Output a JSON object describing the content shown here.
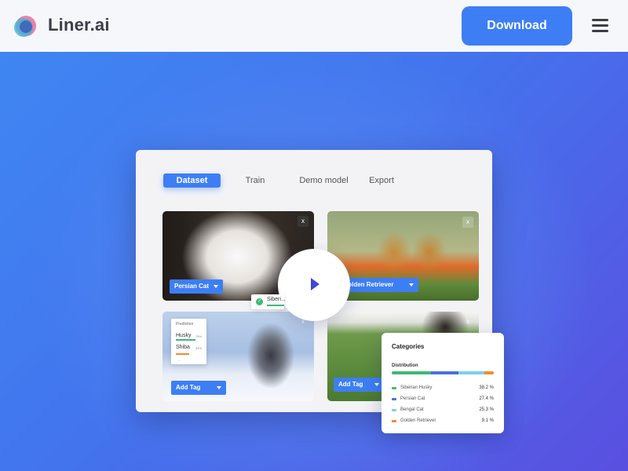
{
  "header": {
    "brand": "Liner.ai",
    "download_label": "Download"
  },
  "colors": {
    "accent": "#3d7ef5",
    "hero_start": "#3f86f2",
    "hero_end": "#5a4fe0"
  },
  "icons": {
    "logo": "liner-logo-icon",
    "menu": "hamburger-menu-icon",
    "play": "play-icon",
    "close": "close-x-icon"
  },
  "app": {
    "tabs": [
      {
        "label": "Dataset",
        "active": true
      },
      {
        "label": "Train",
        "active": false
      },
      {
        "label": "Demo model",
        "active": false
      },
      {
        "label": "Export",
        "active": false
      }
    ],
    "cards": [
      {
        "tag": "Persian Cat",
        "close": "x"
      },
      {
        "tag": "Golden Retriever",
        "close": "x"
      },
      {
        "tag": "Add Tag",
        "close": "x"
      },
      {
        "tag": "Add Tag",
        "close": "x"
      }
    ],
    "chip": {
      "label": "Siberi..."
    },
    "prediction": {
      "title": "Prediction",
      "items": [
        {
          "label": "Husky",
          "pct": "76%"
        },
        {
          "label": "Shiba",
          "pct": "34%"
        }
      ],
      "more": "—"
    },
    "categories": {
      "title": "Categories",
      "distribution_label": "Distribution",
      "items": [
        {
          "name": "Siberian Husky",
          "value": "38.2 %",
          "share": 38.2,
          "color": "#3eb876"
        },
        {
          "name": "Persian Cat",
          "value": "27.4 %",
          "share": 27.4,
          "color": "#4a6fe0"
        },
        {
          "name": "Bengal Cat",
          "value": "25.3 %",
          "share": 25.3,
          "color": "#7ccff0"
        },
        {
          "name": "Golden Retriever",
          "value": "9.1 %",
          "share": 9.1,
          "color": "#f58a2b"
        }
      ]
    }
  }
}
